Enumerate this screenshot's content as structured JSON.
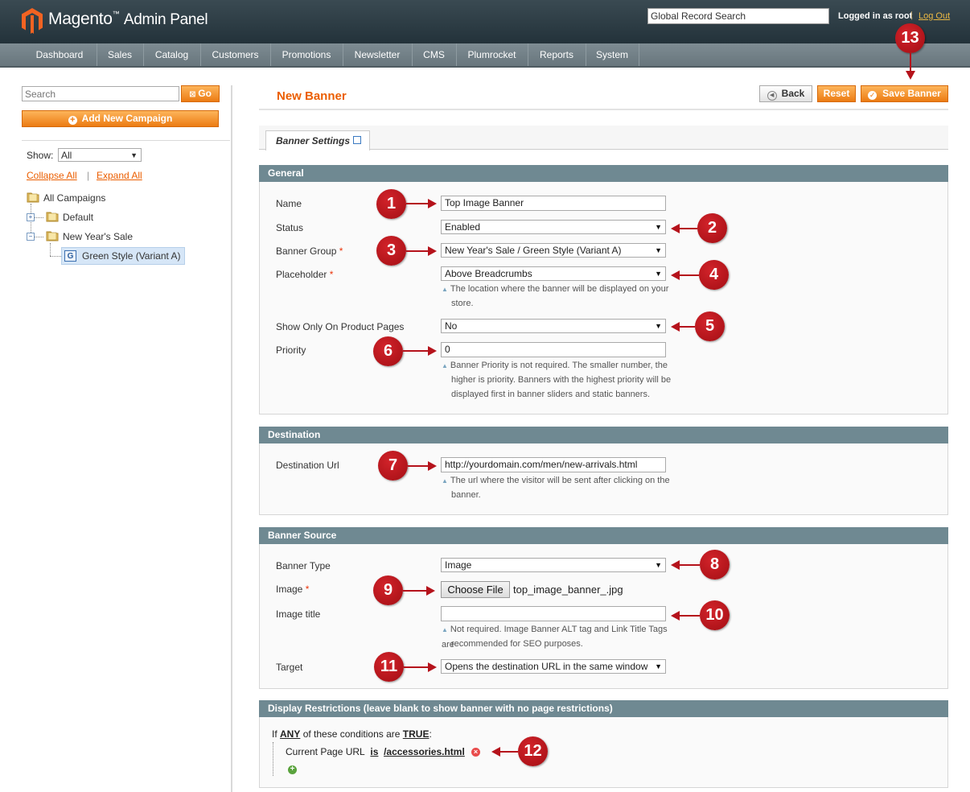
{
  "header": {
    "logo_brand": "Magento",
    "logo_tm": "™",
    "logo_sub": "Admin Panel",
    "global_search_value": "Global Record Search",
    "logged_in": "Logged in as root",
    "separator": "|",
    "logout": "Log Out"
  },
  "nav": {
    "items": [
      {
        "label": "Dashboard"
      },
      {
        "label": "Sales"
      },
      {
        "label": "Catalog"
      },
      {
        "label": "Customers"
      },
      {
        "label": "Promotions"
      },
      {
        "label": "Newsletter"
      },
      {
        "label": "CMS"
      },
      {
        "label": "Plumrocket"
      },
      {
        "label": "Reports"
      },
      {
        "label": "System"
      }
    ]
  },
  "sidebar": {
    "search_placeholder": "Search",
    "go_label": "Go",
    "add_campaign_label": "Add New Campaign",
    "show_label": "Show:",
    "show_value": "All",
    "collapse_all": "Collapse All",
    "pipe": "|",
    "expand_all": "Expand All",
    "tree": {
      "root": "All Campaigns",
      "default": "Default",
      "new_years_sale": "New Year's Sale",
      "green_style": "Green Style (Variant A)",
      "green_style_badge": "G"
    }
  },
  "main": {
    "title": "New Banner",
    "back_label": "Back",
    "reset_label": "Reset",
    "save_label": "Save Banner",
    "tab_label": "Banner Settings",
    "required_mark": "*",
    "general": {
      "title": "General",
      "name_label": "Name",
      "name_value": "Top Image Banner",
      "status_label": "Status",
      "status_value": "Enabled",
      "group_label": "Banner Group",
      "group_value": "New Year's Sale / Green Style (Variant A)",
      "placeholder_label": "Placeholder",
      "placeholder_value": "Above Breadcrumbs",
      "placeholder_note_1": "The location where the banner will be displayed on your",
      "placeholder_note_2": "store.",
      "product_pages_label": "Show Only On Product Pages",
      "product_pages_value": "No",
      "priority_label": "Priority",
      "priority_value": "0",
      "priority_note_1": "Banner Priority is not required. The smaller number, the",
      "priority_note_2": "higher is priority. Banners with the highest priority will be",
      "priority_note_3": "displayed first in banner sliders and static banners."
    },
    "destination": {
      "title": "Destination",
      "url_label": "Destination Url",
      "url_value": "http://yourdomain.com/men/new-arrivals.html",
      "url_note_1": "The url where the visitor will be sent after clicking on the",
      "url_note_2": "banner."
    },
    "source": {
      "title": "Banner Source",
      "type_label": "Banner Type",
      "type_value": "Image",
      "image_label": "Image",
      "choose_file": "Choose File",
      "file_name": "top_image_banner_.jpg",
      "image_title_label": "Image title",
      "image_title_value": "",
      "image_title_note_1": "Not required. Image Banner ALT tag and Link Title Tags are",
      "image_title_note_2": "recommended for SEO purposes.",
      "target_label": "Target",
      "target_value": "Opens the destination URL in the same window"
    },
    "restrictions": {
      "title": "Display Restrictions (leave blank to show banner with no page restrictions)",
      "if": "If",
      "any": "ANY",
      "conditions_text": "of these conditions are",
      "true": "TRUE",
      "colon": ":",
      "condition_attr": "Current Page URL",
      "condition_op": "is",
      "condition_value": "/accessories.html"
    }
  },
  "annotations": [
    "1",
    "2",
    "3",
    "4",
    "5",
    "6",
    "7",
    "8",
    "9",
    "10",
    "11",
    "12",
    "13"
  ],
  "colors": {
    "accent_orange": "#eb5e00",
    "button_orange": "#ec7b13",
    "section_header": "#6f8992",
    "annotation_red": "#b5121b"
  }
}
